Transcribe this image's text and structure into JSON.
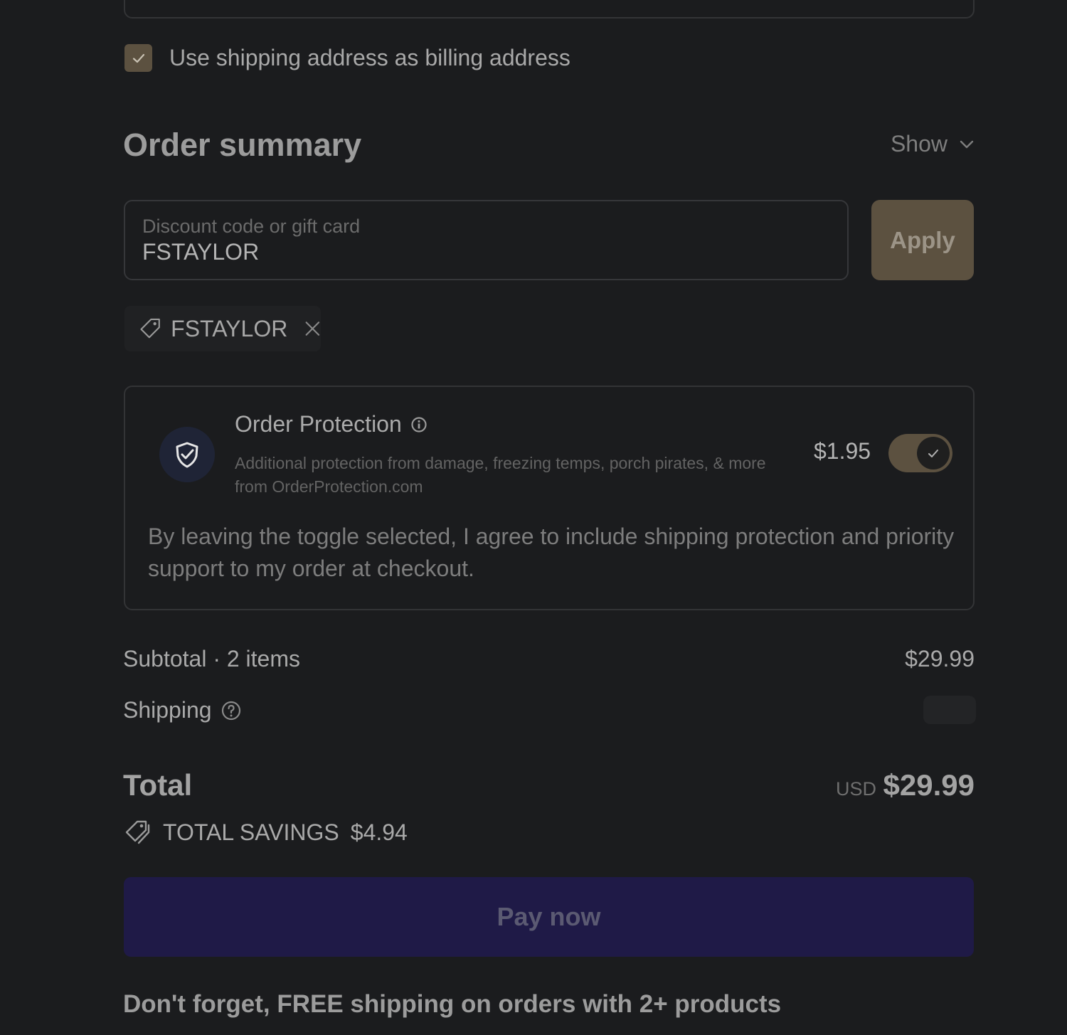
{
  "billing": {
    "checkbox_checked": true,
    "label": "Use shipping address as billing address"
  },
  "summary": {
    "title": "Order summary",
    "show_label": "Show"
  },
  "discount": {
    "placeholder": "Discount code or gift card",
    "value": "FSTAYLOR",
    "apply_label": "Apply",
    "applied_code": "FSTAYLOR"
  },
  "protection": {
    "title": "Order Protection",
    "description": "Additional protection from damage, freezing temps, porch pirates, & more from OrderProtection.com",
    "price": "$1.95",
    "enabled": true,
    "note": "By leaving the toggle selected, I agree to include shipping protection and priority support to my order at checkout."
  },
  "totals": {
    "subtotal_label": "Subtotal · 2 items",
    "subtotal_value": "$29.99",
    "shipping_label": "Shipping",
    "total_label": "Total",
    "currency": "USD",
    "total_value": "$29.99",
    "savings_label": "TOTAL SAVINGS",
    "savings_value": "$4.94"
  },
  "pay": {
    "label": "Pay now"
  },
  "promo": {
    "text": "Don't forget, FREE shipping on orders with 2+ products"
  },
  "colors": {
    "accent": "#5c5140",
    "pay_button": "#1f1a47",
    "background": "#1b1c1e"
  }
}
